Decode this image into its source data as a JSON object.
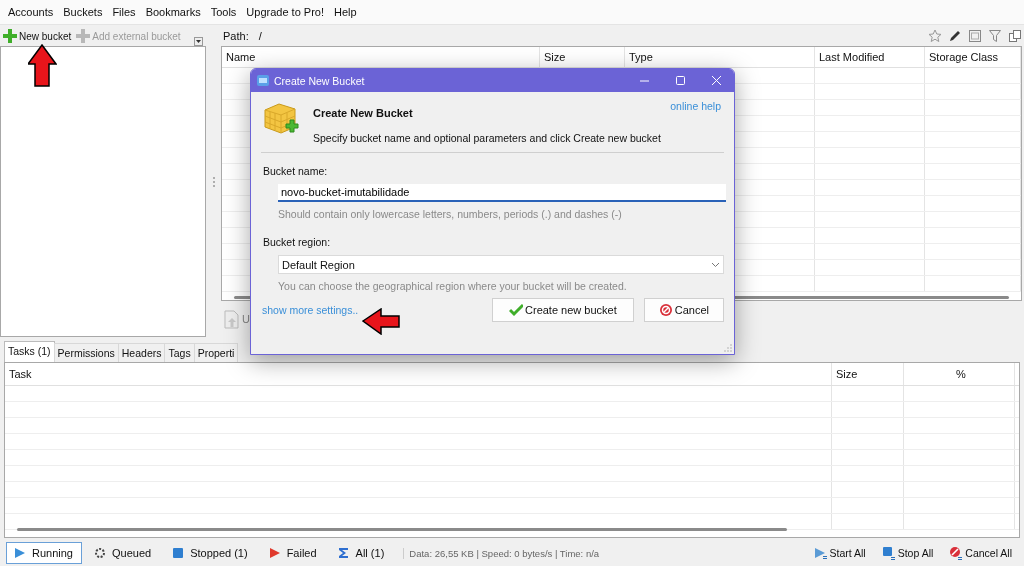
{
  "menu": [
    "Accounts",
    "Buckets",
    "Files",
    "Bookmarks",
    "Tools",
    "Upgrade to Pro!",
    "Help"
  ],
  "bucket_toolbar": [
    {
      "label": "New bucket",
      "disabled": false
    },
    {
      "label": "Add external bucket",
      "disabled": true
    }
  ],
  "path": {
    "label": "Path:",
    "value": "/"
  },
  "files_table": {
    "columns": [
      "Name",
      "Size",
      "Type",
      "Last Modified",
      "Storage Class"
    ]
  },
  "upload_button": {
    "label": "U"
  },
  "tabs": [
    {
      "label": "Tasks (1)",
      "selected": true
    },
    {
      "label": "Permissions",
      "selected": false
    },
    {
      "label": "Headers",
      "selected": false
    },
    {
      "label": "Tags",
      "selected": false
    },
    {
      "label": "Properti",
      "selected": false
    }
  ],
  "tasks_table": {
    "columns": [
      "Task",
      "Size",
      "%"
    ]
  },
  "status_filters": [
    {
      "label": "Running",
      "kind": "running",
      "selected": true
    },
    {
      "label": "Queued",
      "kind": "queued",
      "selected": false
    },
    {
      "label": "Stopped (1)",
      "kind": "stopped",
      "selected": false
    },
    {
      "label": "Failed",
      "kind": "failed",
      "selected": false
    },
    {
      "label": "All (1)",
      "kind": "all",
      "selected": false
    }
  ],
  "status_info": "Data: 26,55 KB | Speed: 0 bytes/s | Time: n/a",
  "actions": [
    {
      "label": "Start All",
      "kind": "start"
    },
    {
      "label": "Stop All",
      "kind": "stop"
    },
    {
      "label": "Cancel All",
      "kind": "cancel"
    }
  ],
  "dialog": {
    "title": "Create New Bucket",
    "heading": "Create New Bucket",
    "description": "Specify bucket name and optional parameters and click Create new bucket",
    "help_link": "online help",
    "name_label": "Bucket name:",
    "name_value": "novo-bucket-imutabilidade",
    "name_hint": "Should contain only lowercase letters, numbers, periods (.) and dashes (-)",
    "region_label": "Bucket region:",
    "region_value": "Default Region",
    "region_hint": "You can choose the geographical region where your bucket will be created.",
    "more_link": "show more settings..",
    "buttons": [
      {
        "label": "Create new bucket",
        "kind": "create"
      },
      {
        "label": "Cancel",
        "kind": "cancel"
      }
    ]
  }
}
